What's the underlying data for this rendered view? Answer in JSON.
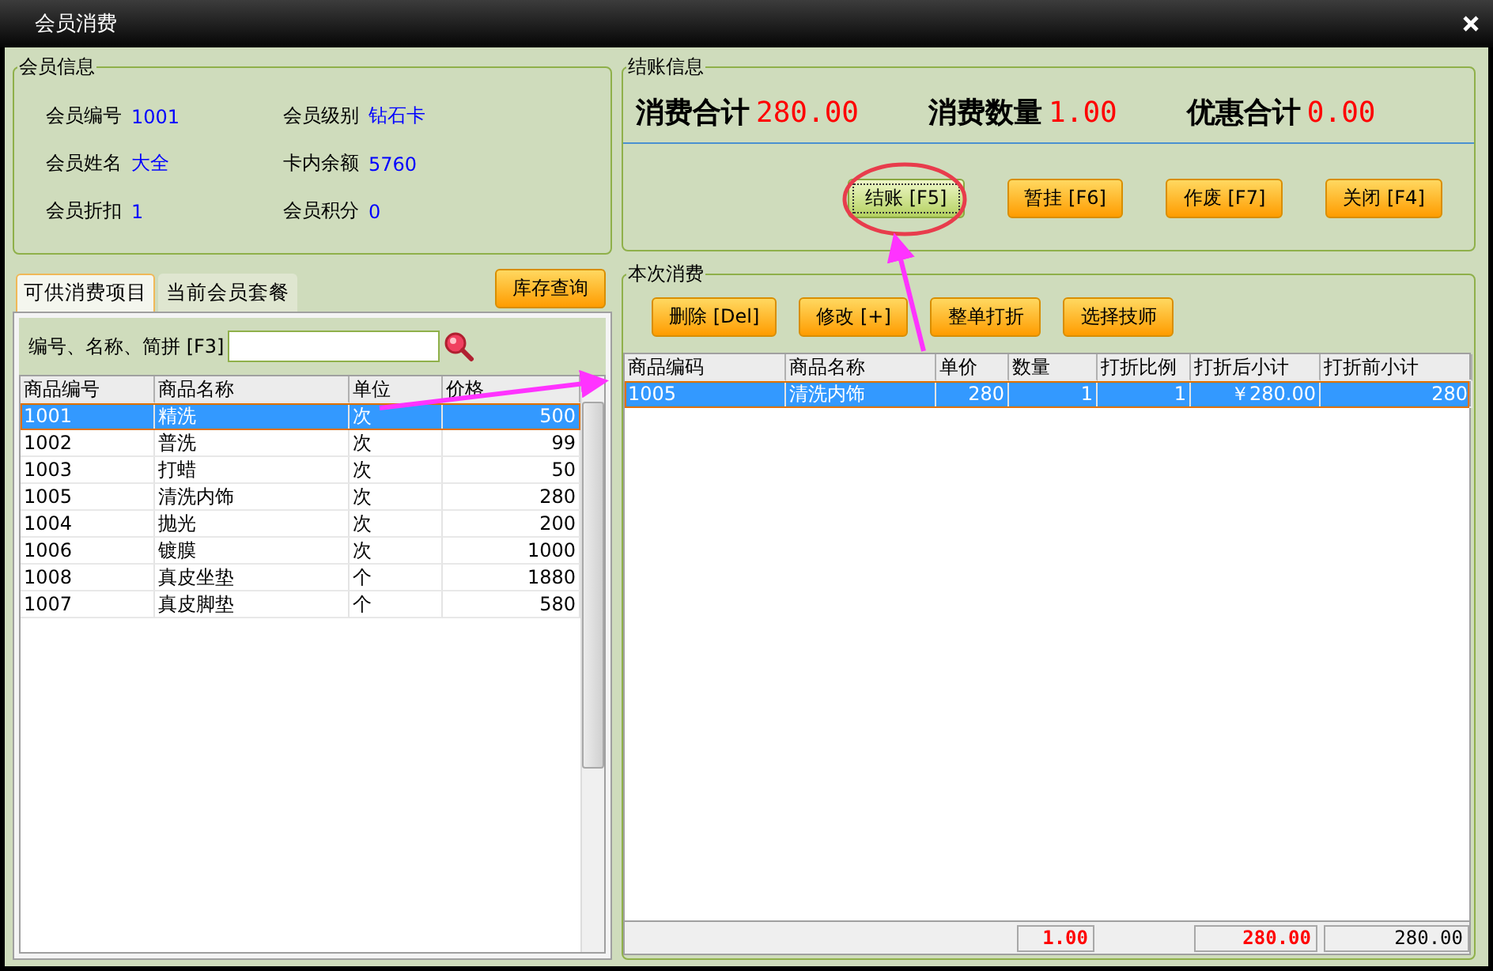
{
  "window": {
    "title": "会员消费"
  },
  "member_info": {
    "title": "会员信息",
    "fields": [
      {
        "label": "会员编号",
        "value": "1001"
      },
      {
        "label": "会员级别",
        "value": "钻石卡"
      },
      {
        "label": "会员姓名",
        "value": "大全"
      },
      {
        "label": "卡内余额",
        "value": "5760"
      },
      {
        "label": "会员折扣",
        "value": "1"
      },
      {
        "label": "会员积分",
        "value": "0"
      }
    ]
  },
  "left_tabs": [
    {
      "label": "可供消费项目",
      "selected": true
    },
    {
      "label": "当前会员套餐",
      "selected": false
    }
  ],
  "stock_button": "库存查询",
  "search": {
    "label": "编号、名称、简拼 [F3]"
  },
  "items_table": {
    "columns": [
      "商品编号",
      "商品名称",
      "单位",
      "价格"
    ],
    "rows": [
      {
        "cells": [
          "1001",
          "精洗",
          "次",
          "500"
        ],
        "selected": true
      },
      {
        "cells": [
          "1002",
          "普洗",
          "次",
          "99"
        ],
        "selected": false
      },
      {
        "cells": [
          "1003",
          "打蜡",
          "次",
          "50"
        ],
        "selected": false
      },
      {
        "cells": [
          "1005",
          "清洗内饰",
          "次",
          "280"
        ],
        "selected": false
      },
      {
        "cells": [
          "1004",
          "抛光",
          "次",
          "200"
        ],
        "selected": false
      },
      {
        "cells": [
          "1006",
          "镀膜",
          "次",
          "1000"
        ],
        "selected": false
      },
      {
        "cells": [
          "1008",
          "真皮坐垫",
          "个",
          "1880"
        ],
        "selected": false
      },
      {
        "cells": [
          "1007",
          "真皮脚垫",
          "个",
          "580"
        ],
        "selected": false
      }
    ]
  },
  "checkout": {
    "title": "结账信息",
    "totals": [
      {
        "label": "消费合计",
        "value": "280.00"
      },
      {
        "label": "消费数量",
        "value": "1.00"
      },
      {
        "label": "优惠合计",
        "value": "0.00"
      }
    ],
    "buttons": [
      {
        "label": "结账 [F5]",
        "focused": true
      },
      {
        "label": "暂挂 [F6]",
        "focused": false
      },
      {
        "label": "作废 [F7]",
        "focused": false
      },
      {
        "label": "关闭 [F4]",
        "focused": false
      }
    ]
  },
  "consumption": {
    "title": "本次消费",
    "buttons": [
      "删除 [Del]",
      "修改 [+]",
      "整单打折",
      "选择技师"
    ],
    "table": {
      "columns": [
        "商品编码",
        "商品名称",
        "单价",
        "数量",
        "打折比例",
        "打折后小计",
        "打折前小计"
      ],
      "rows": [
        {
          "cells": [
            "1005",
            "清洗内饰",
            "280",
            "1",
            "1",
            "￥280.00",
            "280"
          ],
          "selected": true
        }
      ]
    },
    "footer": [
      {
        "value": "1.00",
        "highlight": true
      },
      {
        "value": "280.00",
        "highlight": true
      },
      {
        "value": "280.00",
        "highlight": false
      }
    ]
  }
}
